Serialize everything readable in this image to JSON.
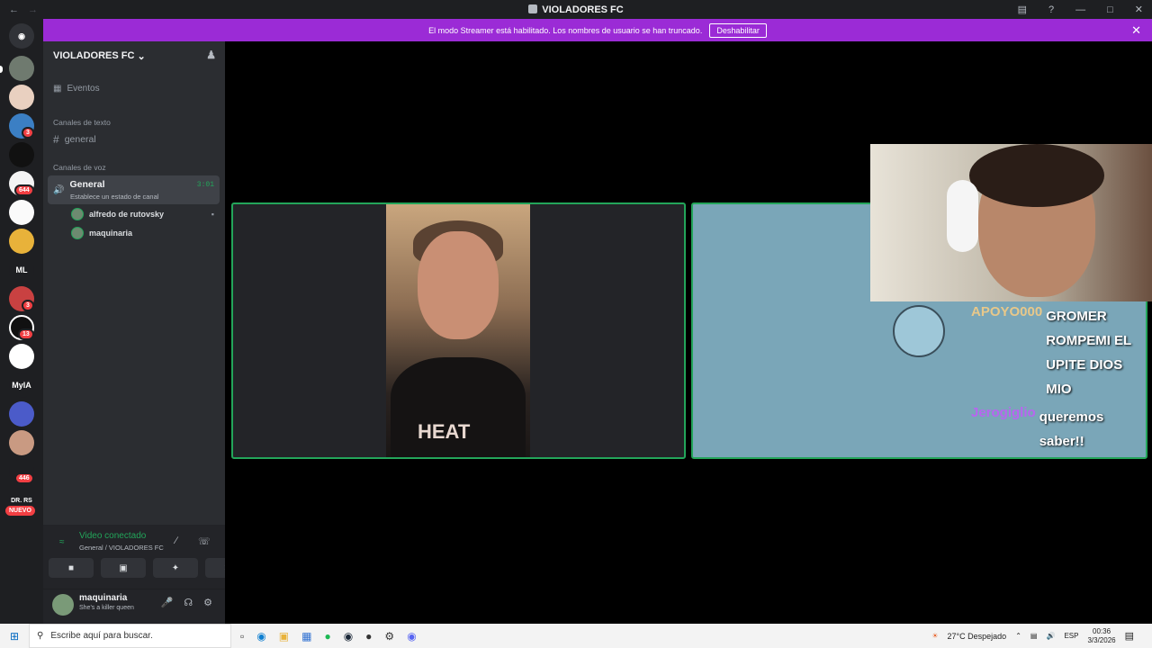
{
  "titlebar": {
    "title": "VIOLADORES FC"
  },
  "streamer_bar": {
    "message": "El modo Streamer está habilitado. Los nombres de usuario se han truncado.",
    "button": "Deshabilitar"
  },
  "servers": [
    {
      "badge": ""
    },
    {
      "badge": ""
    },
    {
      "badge": "3"
    },
    {
      "badge": ""
    },
    {
      "badge": "644"
    },
    {
      "badge": ""
    },
    {
      "badge": ""
    },
    {
      "label": "ML",
      "badge": ""
    },
    {
      "badge": "3"
    },
    {
      "badge": "13"
    },
    {
      "badge": ""
    },
    {
      "label": "MylA",
      "badge": ""
    },
    {
      "badge": ""
    },
    {
      "badge": ""
    },
    {
      "badge": "446"
    },
    {
      "label": "DR. RS",
      "badge": ""
    }
  ],
  "nuevo": "NUEVO",
  "guild": {
    "name": "VIOLADORES FC"
  },
  "channels": {
    "events": "Eventos",
    "text_category": "Canales de texto",
    "text_channel": "general",
    "voice_category": "Canales de voz",
    "voice_channel": "General",
    "voice_status": "Establece un estado de canal",
    "voice_time": "3:01",
    "members": [
      "alfredo de rutovsky",
      "maquinaria"
    ]
  },
  "voice_panel": {
    "status": "Video conectado",
    "location": "General / VIOLADORES FC"
  },
  "user_panel": {
    "name": "maquinaria",
    "status": "She's a killer queen"
  },
  "overlay": {
    "chat": [
      {
        "user": "APOYO000",
        "user_color": "#e8c88a",
        "message": "GROMER ROMPEMI EL UPITE DIOS MIO"
      },
      {
        "user": "Jerogiglio",
        "user_color": "#b865f0",
        "message": "queremos saber!!"
      }
    ]
  },
  "tile1": {
    "shirt_text": "HEAT"
  },
  "taskbar": {
    "search_placeholder": "Escribe aquí para buscar.",
    "weather": "27°C  Despejado",
    "lang": "ESP",
    "time": "00:36",
    "date": "3/3/2026"
  }
}
